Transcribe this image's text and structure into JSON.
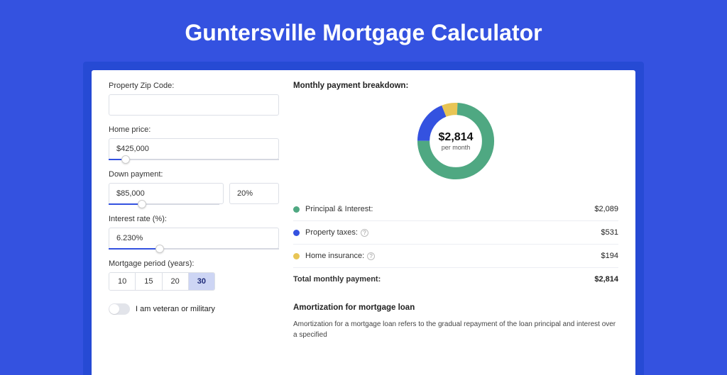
{
  "title": "Guntersville Mortgage Calculator",
  "form": {
    "zip": {
      "label": "Property Zip Code:",
      "value": ""
    },
    "homePrice": {
      "label": "Home price:",
      "value": "$425,000",
      "sliderPercent": 10
    },
    "downPayment": {
      "label": "Down payment:",
      "value": "$85,000",
      "percent": "20%",
      "sliderPercent": 20
    },
    "interestRate": {
      "label": "Interest rate (%):",
      "value": "6.230%",
      "sliderPercent": 30
    },
    "period": {
      "label": "Mortgage period (years):",
      "options": [
        "10",
        "15",
        "20",
        "30"
      ],
      "selected": "30"
    },
    "veteran": {
      "label": "I am veteran or military",
      "checked": false
    }
  },
  "breakdown": {
    "title": "Monthly payment breakdown:",
    "total": "$2,814",
    "sub": "per month",
    "items": [
      {
        "label": "Principal & Interest:",
        "value": "$2,089",
        "color": "#4fa882",
        "help": false
      },
      {
        "label": "Property taxes:",
        "value": "$531",
        "color": "#3452e0",
        "help": true
      },
      {
        "label": "Home insurance:",
        "value": "$194",
        "color": "#e8c555",
        "help": true
      }
    ],
    "totalRow": {
      "label": "Total monthly payment:",
      "value": "$2,814"
    }
  },
  "chart_data": {
    "type": "pie",
    "title": "Monthly payment breakdown",
    "series": [
      {
        "name": "Principal & Interest",
        "value": 2089,
        "color": "#4fa882"
      },
      {
        "name": "Property taxes",
        "value": 531,
        "color": "#3452e0"
      },
      {
        "name": "Home insurance",
        "value": 194,
        "color": "#e8c555"
      }
    ],
    "total": 2814,
    "center_label": "$2,814 per month"
  },
  "amortization": {
    "title": "Amortization for mortgage loan",
    "text": "Amortization for a mortgage loan refers to the gradual repayment of the loan principal and interest over a specified"
  }
}
